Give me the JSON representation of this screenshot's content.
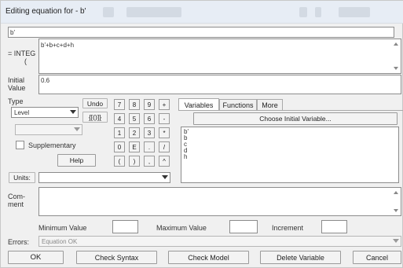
{
  "window": {
    "title": "Editing equation for - b'"
  },
  "name_field": {
    "value": "b'"
  },
  "equation": {
    "prefix_label": "= INTEG",
    "paren": "(",
    "value": "b'+b+c+d+h"
  },
  "initial_value": {
    "label_line1": "Initial",
    "label_line2": "Value",
    "value": "0.6"
  },
  "type": {
    "label": "Type",
    "selected": "Level",
    "sub_selected": "",
    "supplementary_label": "Supplementary",
    "supplementary_checked": false
  },
  "buttons": {
    "undo": "Undo",
    "braces": "{[()]}",
    "help": "Help",
    "ok": "OK",
    "check_syntax": "Check Syntax",
    "check_model": "Check Model",
    "delete_variable": "Delete Variable",
    "cancel": "Cancel",
    "choose_initial_variable": "Choose Initial Variable..."
  },
  "keypad": {
    "keys": [
      "7",
      "8",
      "9",
      "+",
      "4",
      "5",
      "6",
      "-",
      "1",
      "2",
      "3",
      "*",
      "0",
      "E",
      ".",
      "/",
      "(",
      ")",
      ",",
      "^"
    ]
  },
  "tabs": [
    {
      "label": "Variables",
      "active": true
    },
    {
      "label": "Functions",
      "active": false
    },
    {
      "label": "More",
      "active": false
    }
  ],
  "variables": [
    "b'",
    "b",
    "c",
    "d",
    "h"
  ],
  "units": {
    "label": "Units:",
    "value": ""
  },
  "comment": {
    "label_line1": "Com-",
    "label_line2": "ment",
    "value": ""
  },
  "range": {
    "min_label": "Minimum Value",
    "max_label": "Maximum Value",
    "increment_label": "Increment",
    "min_value": "",
    "max_value": "",
    "increment_value": ""
  },
  "errors": {
    "label": "Errors:",
    "value": "Equation OK"
  }
}
